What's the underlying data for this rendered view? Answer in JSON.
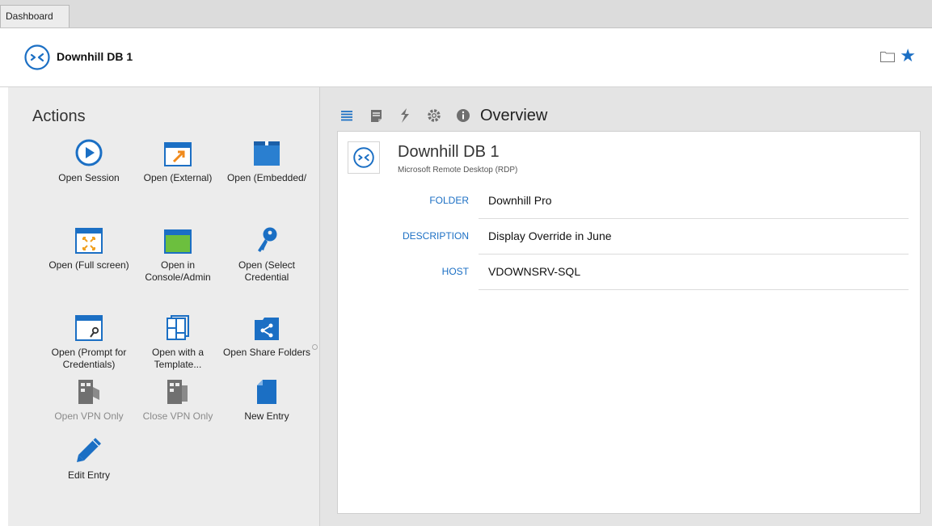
{
  "tabs": [
    {
      "label": "Dashboard"
    }
  ],
  "header": {
    "title": "Downhill DB 1",
    "icon": "remote-desktop-icon",
    "accent": "#1b6fc4"
  },
  "actions": {
    "title": "Actions",
    "items": [
      {
        "label": "Open Session",
        "icon": "play-circle-icon",
        "enabled": true
      },
      {
        "label": "Open (External)",
        "icon": "external-window-icon",
        "enabled": true
      },
      {
        "label": "Open (Embedded/",
        "icon": "embedded-window-icon",
        "enabled": true
      },
      {
        "label": "Open (Full screen)",
        "icon": "fullscreen-icon",
        "enabled": true
      },
      {
        "label": "Open in Console/Admin",
        "icon": "console-window-icon",
        "enabled": true
      },
      {
        "label": "Open (Select Credential",
        "icon": "key-icon",
        "enabled": true
      },
      {
        "label": "Open (Prompt for Credentials)",
        "icon": "prompt-credentials-icon",
        "enabled": true
      },
      {
        "label": "Open with a Template...",
        "icon": "template-icon",
        "enabled": true
      },
      {
        "label": "Open Share Folders",
        "icon": "share-folder-icon",
        "enabled": true
      },
      {
        "label": "Open VPN Only",
        "icon": "vpn-open-icon",
        "enabled": false
      },
      {
        "label": "Close VPN Only",
        "icon": "vpn-close-icon",
        "enabled": false
      },
      {
        "label": "New Entry",
        "icon": "new-entry-icon",
        "enabled": true
      },
      {
        "label": "Edit Entry",
        "icon": "pencil-icon",
        "enabled": true
      }
    ]
  },
  "overview": {
    "label": "Overview",
    "toolbar_icons": [
      "list-icon",
      "notes-icon",
      "macro-icon",
      "gear-icon",
      "info-icon"
    ],
    "entry": {
      "title": "Downhill DB 1",
      "subtitle": "Microsoft Remote Desktop (RDP)",
      "fields": [
        {
          "label": "FOLDER",
          "value": "Downhill Pro"
        },
        {
          "label": "DESCRIPTION",
          "value": "Display Override in June"
        },
        {
          "label": "HOST",
          "value": "VDOWNSRV-SQL"
        }
      ]
    }
  }
}
